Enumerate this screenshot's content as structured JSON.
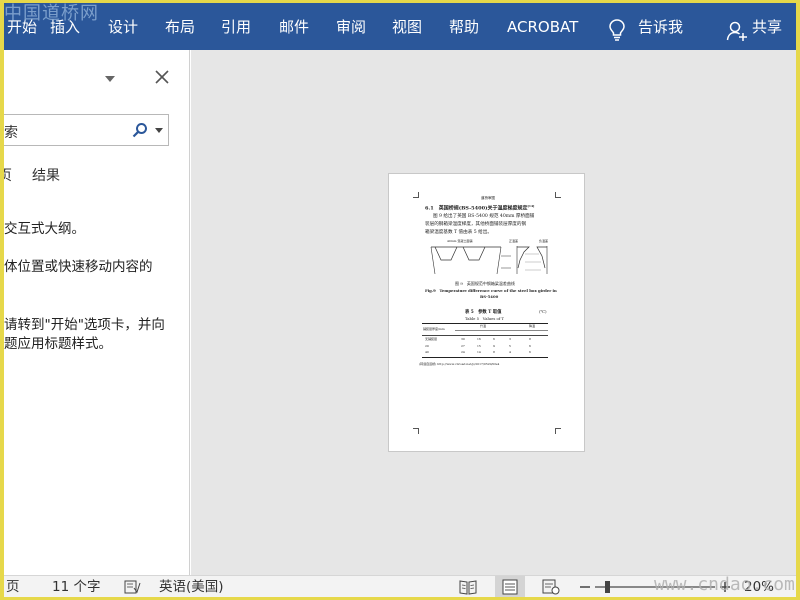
{
  "watermark_top": "中国道桥网",
  "ribbon": {
    "tabs": [
      "开始",
      "插入",
      "设计",
      "布局",
      "引用",
      "邮件",
      "审阅",
      "视图",
      "帮助",
      "ACROBAT"
    ],
    "tell_me": "告诉我",
    "share": "共享"
  },
  "nav_pane": {
    "search_text": "索",
    "tabs": {
      "pages": "页",
      "results": "结果"
    },
    "paragraphs": [
      "交互式大纲。",
      "体位置或快速移动内容的",
      "请转到\"开始\"选项卡，并向",
      "题应用标题样式。"
    ]
  },
  "document": {
    "header": "道桥审图",
    "section": "6.1　英国桥规(BS-5400)关于温度梯度规定",
    "section_ref": "[14]",
    "body": [
      "图 9 给出了英国 BS-5400 规范 40mm 厚桥面铺",
      "装层的钢箱梁温度梯度，其他桥面铺装层厚度的钢",
      "箱梁温度基数 T 值由表 5 给出。"
    ],
    "figure_labels": [
      "40mm 混凝土面铺",
      "正温差",
      "负温差"
    ],
    "figure_caption_cn": "图 9　英国规范中钢箱梁温差曲线",
    "figure_caption_en": "Fig.9　Temperature difference curve of the steel box girder in",
    "figure_caption_en2": "BS-5400",
    "table_title_cn": "表 5　参数 T 取值",
    "table_unit": "(℃)",
    "table_title_en": "Table 5　Values of T",
    "table_header": [
      "铺装层厚度/mm",
      "升温",
      "降温"
    ],
    "table_rows": [
      [
        "无铺装层",
        "30",
        "16",
        "6",
        "3",
        "8"
      ],
      [
        "20",
        "27",
        "15",
        "9",
        "5",
        "6"
      ],
      [
        "40",
        "24",
        "14",
        "8",
        "4",
        "6"
      ]
    ],
    "footer": "(转载自道桥) http://www.cnroad.net/p/2017/0520/0fe4"
  },
  "status": {
    "page": "页",
    "word_count": "11 个字",
    "language": "英语(美国)",
    "zoom": "20%",
    "zoom_level": 0.2
  },
  "watermark_bottom": "www.cndao.com"
}
